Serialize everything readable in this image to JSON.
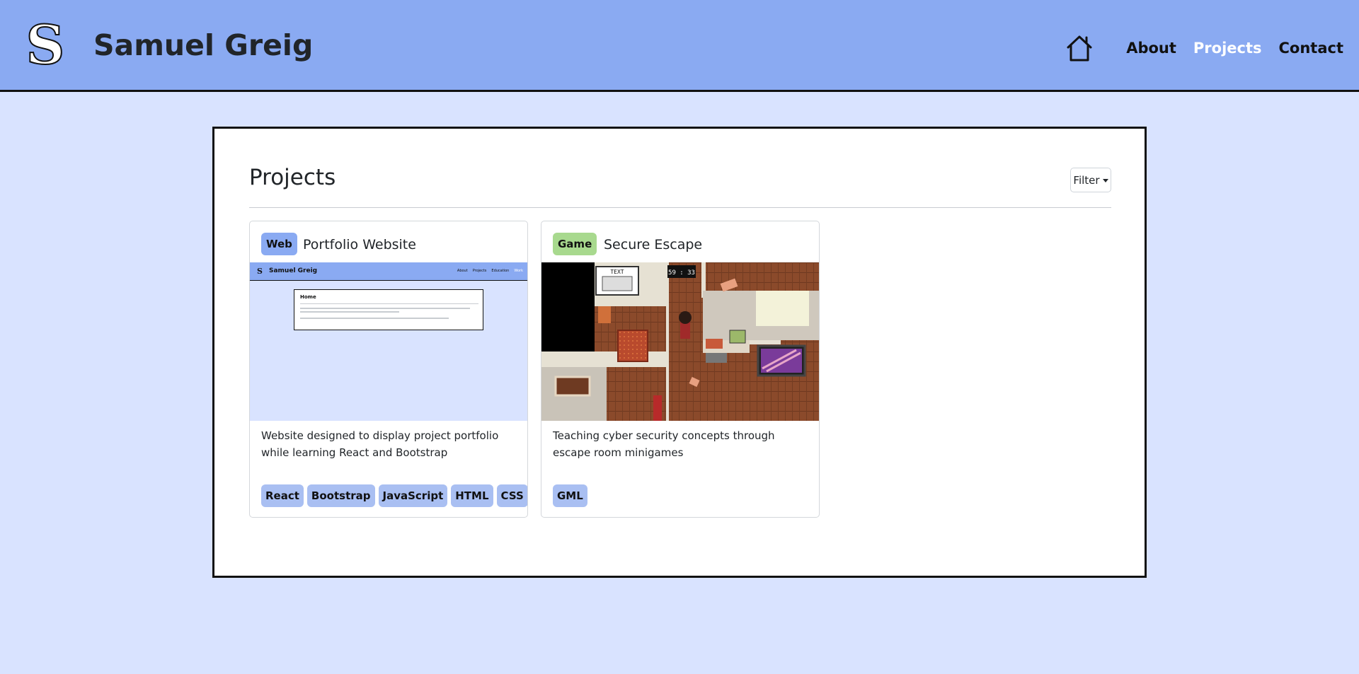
{
  "header": {
    "brand": "Samuel Greig",
    "logo_letter": "S",
    "nav": {
      "about": "About",
      "projects": "Projects",
      "contact": "Contact"
    }
  },
  "main": {
    "title": "Projects",
    "filter_label": "Filter"
  },
  "projects": [
    {
      "category": "Web",
      "category_color": "#8aaaf2",
      "title": "Portfolio Website",
      "description": "Website designed to display project portfolio while learning React and Bootstrap",
      "tags": [
        "React",
        "Bootstrap",
        "JavaScript",
        "HTML",
        "CSS"
      ],
      "preview": {
        "brand": "Samuel Greig",
        "nav": [
          "About",
          "Projects",
          "Education",
          "Work"
        ],
        "panel_title": "Home"
      }
    },
    {
      "category": "Game",
      "category_color": "#a8d98e",
      "title": "Secure Escape",
      "description": "Teaching cyber security concepts through escape room minigames",
      "tags": [
        "GML"
      ],
      "preview": {
        "timer": "59 : 33",
        "sign": "TEXT"
      }
    }
  ],
  "colors": {
    "navbar": "#8aaaf2",
    "background": "#d9e3ff",
    "active_link": "#ffffff",
    "tag": "#a9bff2"
  }
}
